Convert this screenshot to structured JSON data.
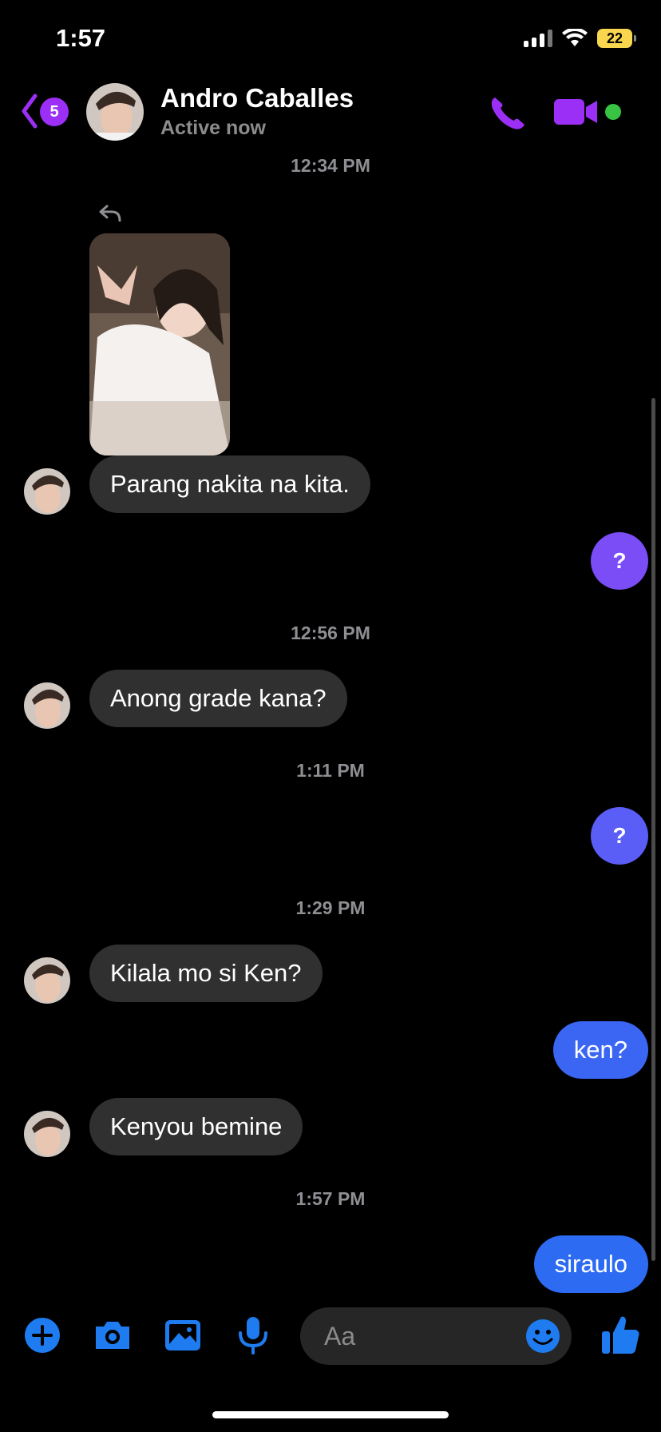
{
  "status_bar": {
    "time": "1:57",
    "battery": "22"
  },
  "header": {
    "back_badge": "5",
    "contact_name": "Andro Caballes",
    "contact_status": "Active now"
  },
  "messages": [
    {
      "type": "timestamp",
      "text": "12:34 PM"
    },
    {
      "type": "incoming_photo"
    },
    {
      "type": "incoming",
      "text": "Parang nakita na kita."
    },
    {
      "type": "outgoing",
      "text": "?"
    },
    {
      "type": "timestamp",
      "text": "12:56 PM"
    },
    {
      "type": "incoming",
      "text": "Anong grade kana?"
    },
    {
      "type": "timestamp",
      "text": "1:11 PM"
    },
    {
      "type": "outgoing",
      "text": "?"
    },
    {
      "type": "timestamp",
      "text": "1:29 PM"
    },
    {
      "type": "incoming",
      "text": "Kilala mo si Ken?"
    },
    {
      "type": "outgoing",
      "text": "ken?"
    },
    {
      "type": "incoming",
      "text": "Kenyou bemine"
    },
    {
      "type": "timestamp",
      "text": "1:57 PM"
    },
    {
      "type": "outgoing",
      "text": "siraulo"
    }
  ],
  "composer": {
    "placeholder": "Aa"
  },
  "colors": {
    "accent_purple": "#9b2ff5",
    "outgoing_purple": "#7a4df7",
    "outgoing_blue": "#2c6bf2",
    "incoming_bubble": "#303030",
    "composer_blue": "#1e7cf0"
  },
  "icons": {
    "back": "chevron-left-icon",
    "call": "phone-icon",
    "video": "video-camera-icon",
    "plus": "plus-circle-icon",
    "camera": "camera-icon",
    "gallery": "photo-icon",
    "mic": "microphone-icon",
    "emoji": "smiley-icon",
    "like": "thumbs-up-icon",
    "reply": "reply-arrow-icon"
  }
}
